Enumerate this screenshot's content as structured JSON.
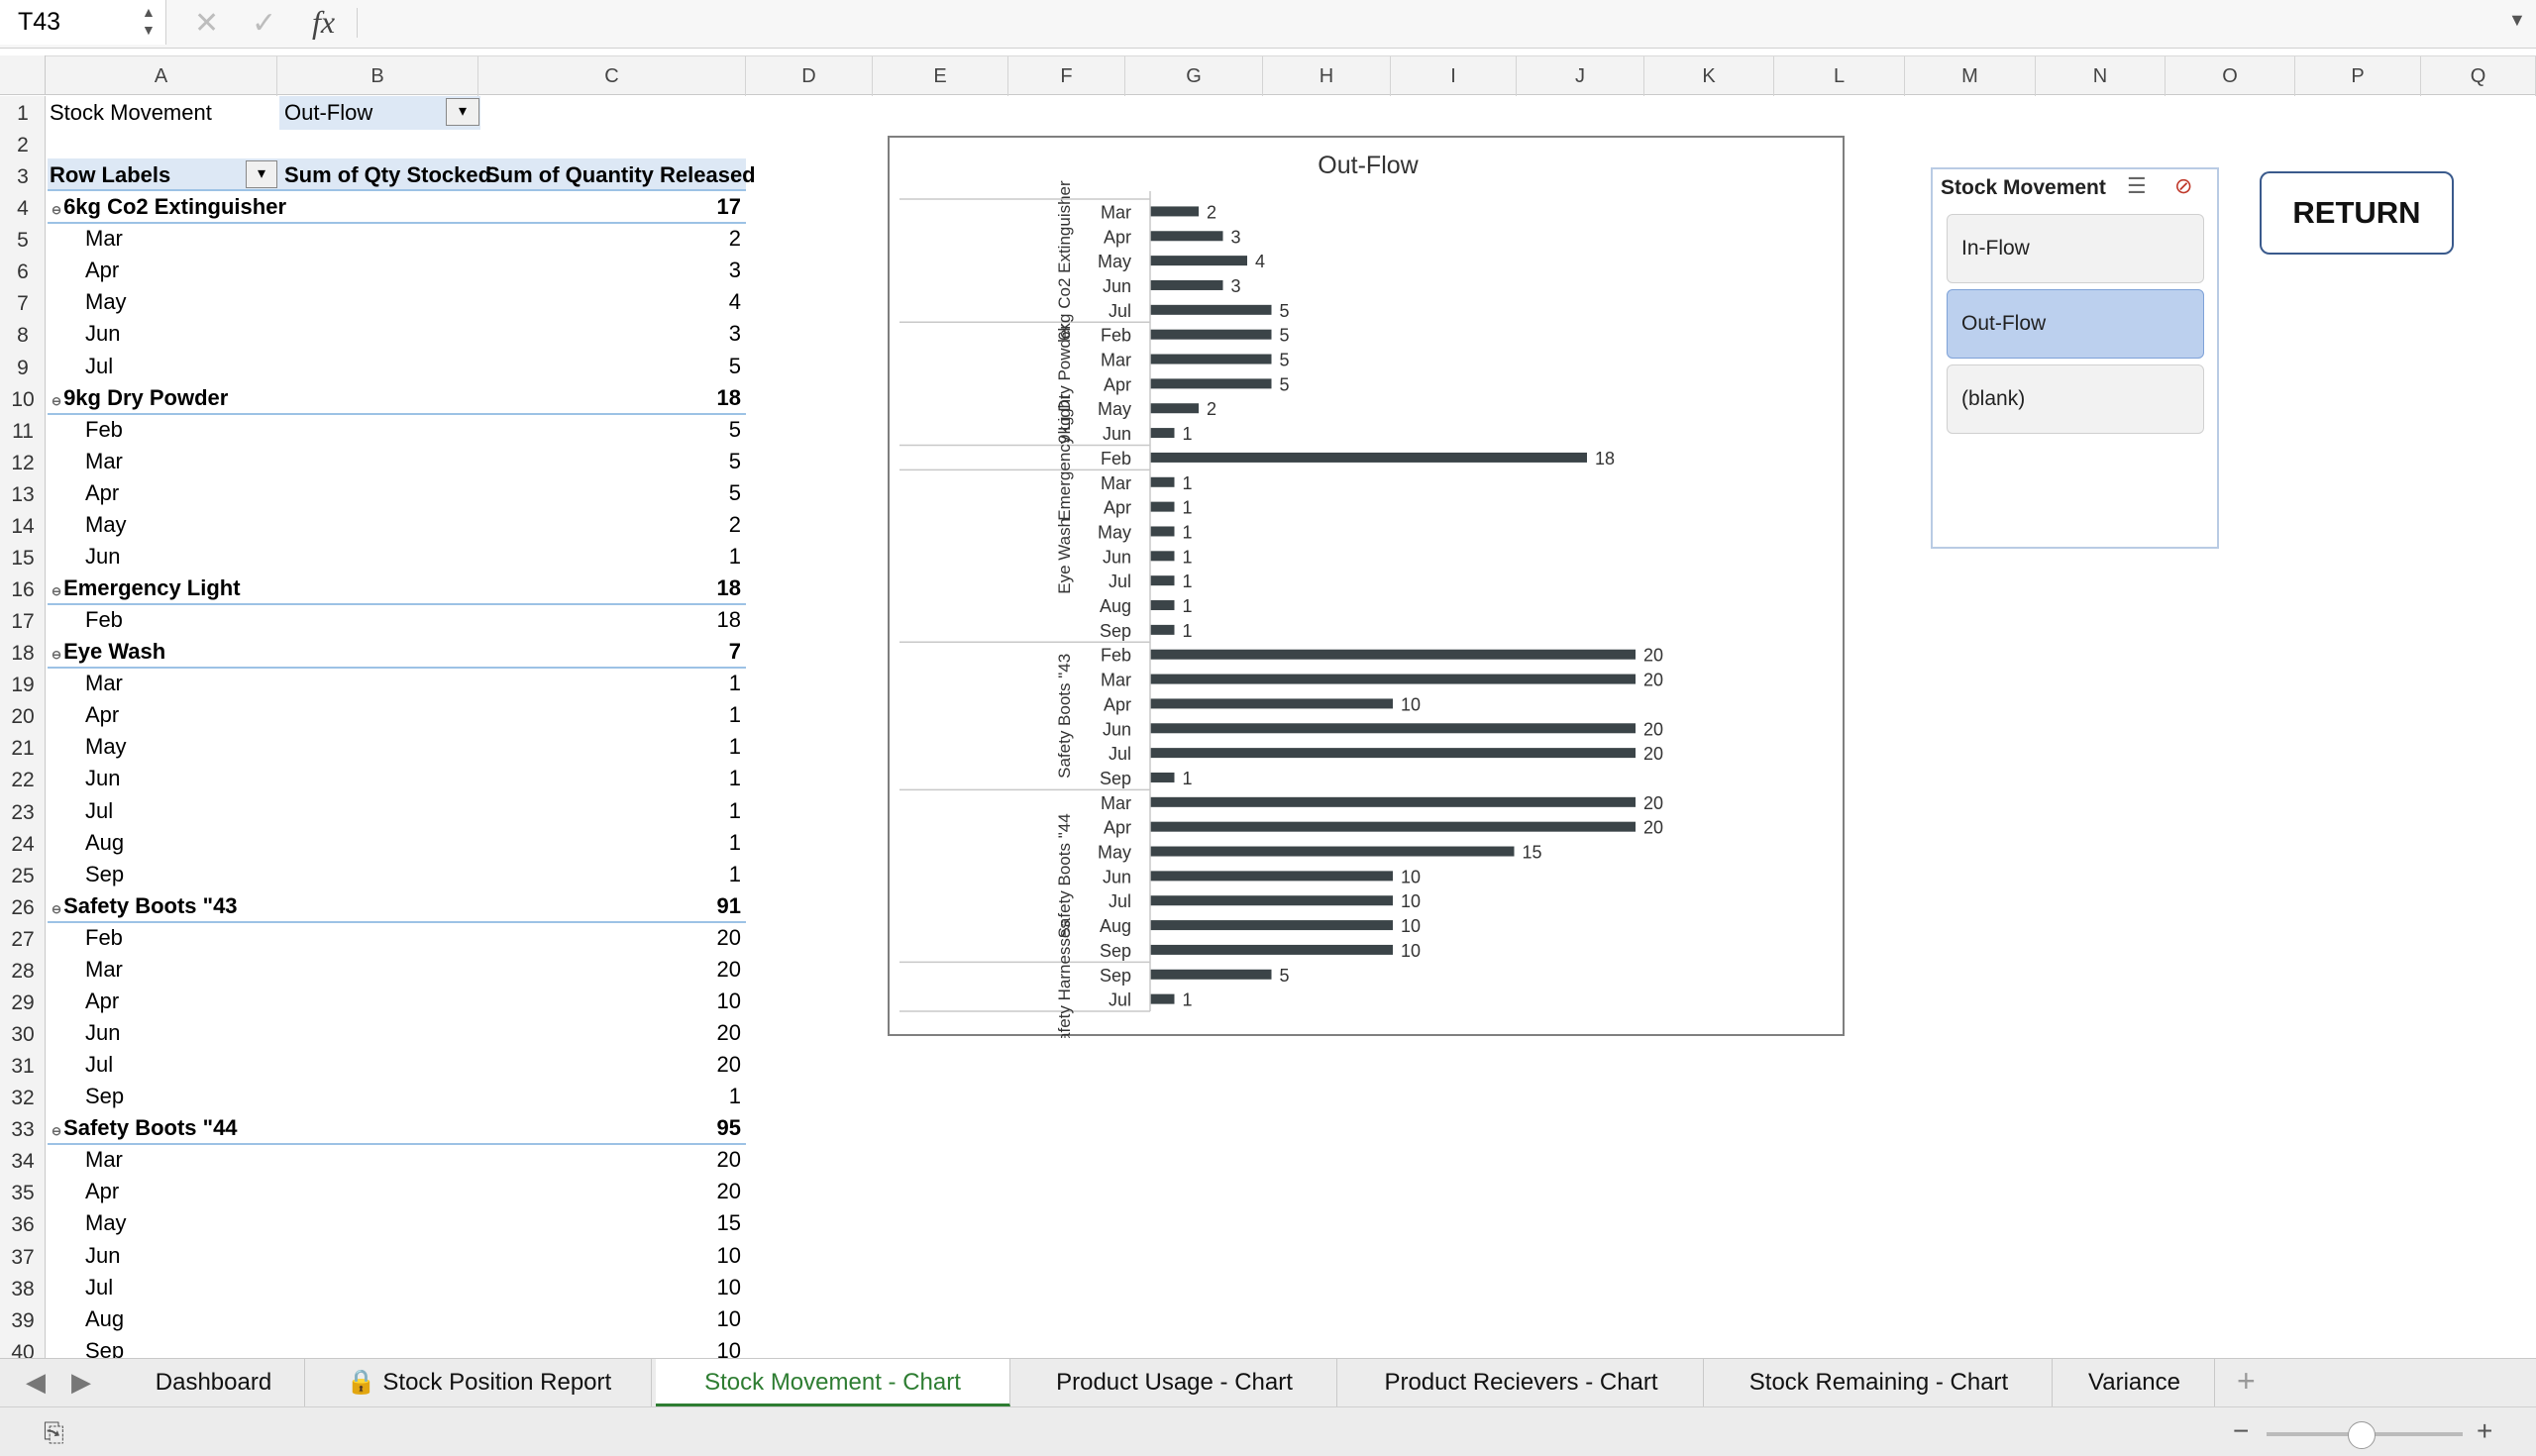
{
  "namebox": {
    "value": "T43"
  },
  "formula_bar": {
    "fx": "fx",
    "content": ""
  },
  "columns": [
    "A",
    "B",
    "C",
    "D",
    "E",
    "F",
    "G",
    "H",
    "I",
    "J",
    "K",
    "L",
    "M",
    "N",
    "O",
    "P",
    "Q"
  ],
  "cells": {
    "a1": "Stock Movement",
    "b1": "Out-Flow",
    "a3": "Row Labels",
    "b3": "Sum of Qty Stocked",
    "c3": "Sum of Quantity Released"
  },
  "pivot_rows": [
    {
      "label": "6kg Co2 Extinguisher",
      "value": "17",
      "group": true
    },
    {
      "label": "Mar",
      "value": "2"
    },
    {
      "label": "Apr",
      "value": "3"
    },
    {
      "label": "May",
      "value": "4"
    },
    {
      "label": "Jun",
      "value": "3"
    },
    {
      "label": "Jul",
      "value": "5"
    },
    {
      "label": "9kg Dry Powder",
      "value": "18",
      "group": true
    },
    {
      "label": "Feb",
      "value": "5"
    },
    {
      "label": "Mar",
      "value": "5"
    },
    {
      "label": "Apr",
      "value": "5"
    },
    {
      "label": "May",
      "value": "2"
    },
    {
      "label": "Jun",
      "value": "1"
    },
    {
      "label": "Emergency Light",
      "value": "18",
      "group": true
    },
    {
      "label": "Feb",
      "value": "18"
    },
    {
      "label": "Eye Wash",
      "value": "7",
      "group": true
    },
    {
      "label": "Mar",
      "value": "1"
    },
    {
      "label": "Apr",
      "value": "1"
    },
    {
      "label": "May",
      "value": "1"
    },
    {
      "label": "Jun",
      "value": "1"
    },
    {
      "label": "Jul",
      "value": "1"
    },
    {
      "label": "Aug",
      "value": "1"
    },
    {
      "label": "Sep",
      "value": "1"
    },
    {
      "label": "Safety Boots \"43",
      "value": "91",
      "group": true
    },
    {
      "label": "Feb",
      "value": "20"
    },
    {
      "label": "Mar",
      "value": "20"
    },
    {
      "label": "Apr",
      "value": "10"
    },
    {
      "label": "Jun",
      "value": "20"
    },
    {
      "label": "Jul",
      "value": "20"
    },
    {
      "label": "Sep",
      "value": "1"
    },
    {
      "label": "Safety Boots \"44",
      "value": "95",
      "group": true
    },
    {
      "label": "Mar",
      "value": "20"
    },
    {
      "label": "Apr",
      "value": "20"
    },
    {
      "label": "May",
      "value": "15"
    },
    {
      "label": "Jun",
      "value": "10"
    },
    {
      "label": "Jul",
      "value": "10"
    },
    {
      "label": "Aug",
      "value": "10"
    },
    {
      "label": "Sep",
      "value": "10"
    }
  ],
  "chart_data": {
    "type": "bar",
    "orientation": "horizontal",
    "title": "Out-Flow",
    "groups": [
      {
        "name": "6kg Co2 Extinguisher",
        "categories": [
          "Mar",
          "Apr",
          "May",
          "Jun",
          "Jul"
        ],
        "values": [
          2,
          3,
          4,
          3,
          5
        ]
      },
      {
        "name": "9kg Dry Powder",
        "categories": [
          "Feb",
          "Mar",
          "Apr",
          "May",
          "Jun"
        ],
        "values": [
          5,
          5,
          5,
          2,
          1
        ]
      },
      {
        "name": "Emergency Light",
        "categories": [
          "Feb"
        ],
        "values": [
          18
        ]
      },
      {
        "name": "Eye Wash",
        "categories": [
          "Mar",
          "Apr",
          "May",
          "Jun",
          "Jul",
          "Aug",
          "Sep"
        ],
        "values": [
          1,
          1,
          1,
          1,
          1,
          1,
          1
        ]
      },
      {
        "name": "Safety Boots \"43",
        "categories": [
          "Feb",
          "Mar",
          "Apr",
          "Jun",
          "Jul",
          "Sep"
        ],
        "values": [
          20,
          20,
          10,
          20,
          20,
          1
        ]
      },
      {
        "name": "Safety Boots \"44",
        "categories": [
          "Mar",
          "Apr",
          "May",
          "Jun",
          "Jul",
          "Aug",
          "Sep"
        ],
        "values": [
          20,
          20,
          15,
          10,
          10,
          10,
          10
        ]
      },
      {
        "name": "Safety Harnesses",
        "categories": [
          "Sep",
          "Jul"
        ],
        "values": [
          5,
          1
        ]
      }
    ],
    "xlim": [
      0,
      20
    ],
    "bar_color": "#3b4448",
    "legend": "none",
    "grid": false
  },
  "slicer": {
    "title": "Stock Movement",
    "items": [
      {
        "label": "In-Flow",
        "selected": false
      },
      {
        "label": "Out-Flow",
        "selected": true
      },
      {
        "label": "(blank)",
        "selected": false
      }
    ]
  },
  "return_button": {
    "label": "RETURN"
  },
  "tabs": [
    {
      "label": "Dashboard",
      "locked": false,
      "active": false
    },
    {
      "label": "Stock Position Report",
      "locked": true,
      "active": false
    },
    {
      "label": "Stock Movement - Chart",
      "locked": false,
      "active": true
    },
    {
      "label": "Product Usage - Chart",
      "locked": false,
      "active": false
    },
    {
      "label": "Product Recievers - Chart",
      "locked": false,
      "active": false
    },
    {
      "label": "Stock Remaining - Chart",
      "locked": false,
      "active": false
    },
    {
      "label": "Variance",
      "locked": false,
      "active": false
    }
  ],
  "colors": {
    "accent_green": "#2e7d32",
    "pivot_header": "#dde8f5",
    "slicer_selected": "#bcd0ee"
  }
}
